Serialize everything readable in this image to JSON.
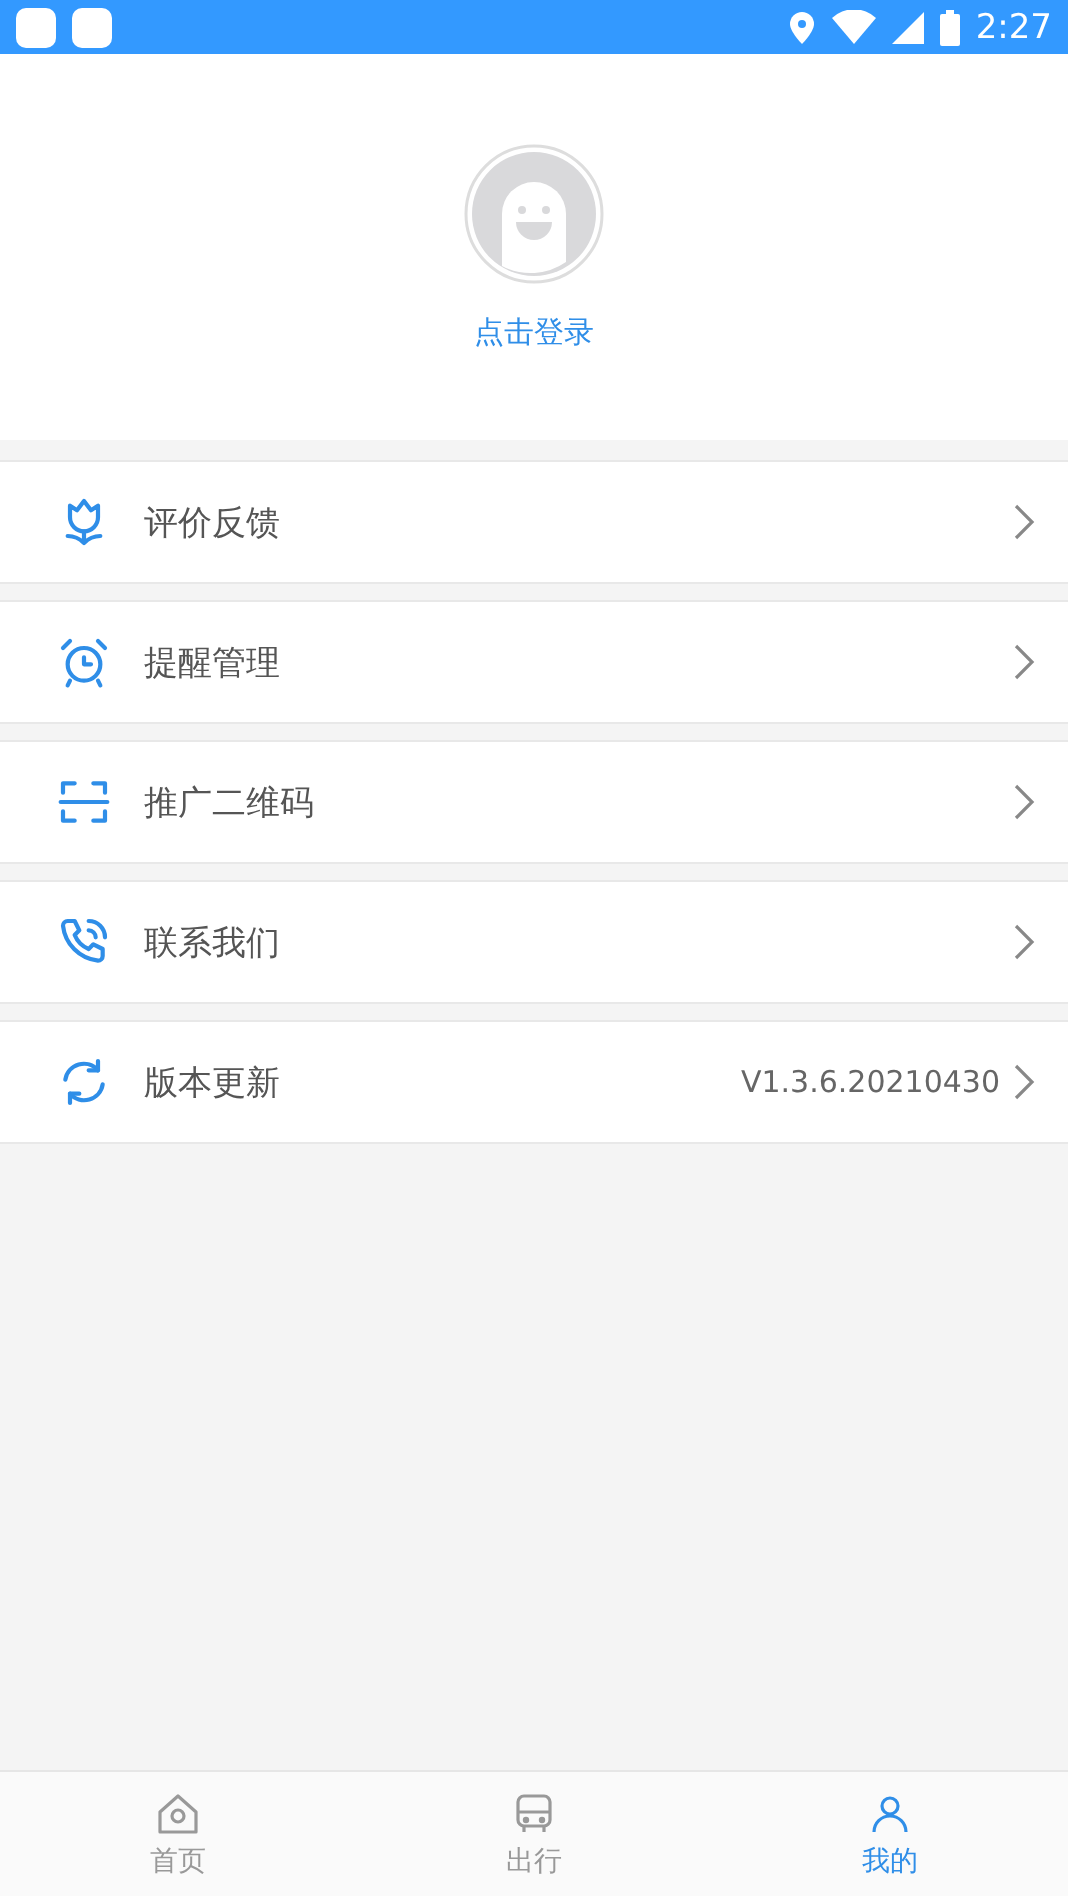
{
  "status_bar": {
    "time": "2:27"
  },
  "profile": {
    "login_label": "点击登录"
  },
  "menu": [
    {
      "kind": "feedback",
      "label": "评价反馈"
    },
    {
      "kind": "reminder",
      "label": "提醒管理"
    },
    {
      "kind": "qrcode",
      "label": "推广二维码"
    },
    {
      "kind": "contact",
      "label": "联系我们"
    },
    {
      "kind": "update",
      "label": "版本更新",
      "value": "V1.3.6.20210430"
    }
  ],
  "tab_bar": [
    {
      "kind": "home",
      "label": "首页",
      "selected": false
    },
    {
      "kind": "bus",
      "label": "出行",
      "selected": false
    },
    {
      "kind": "user",
      "label": "我的",
      "selected": true
    }
  ]
}
